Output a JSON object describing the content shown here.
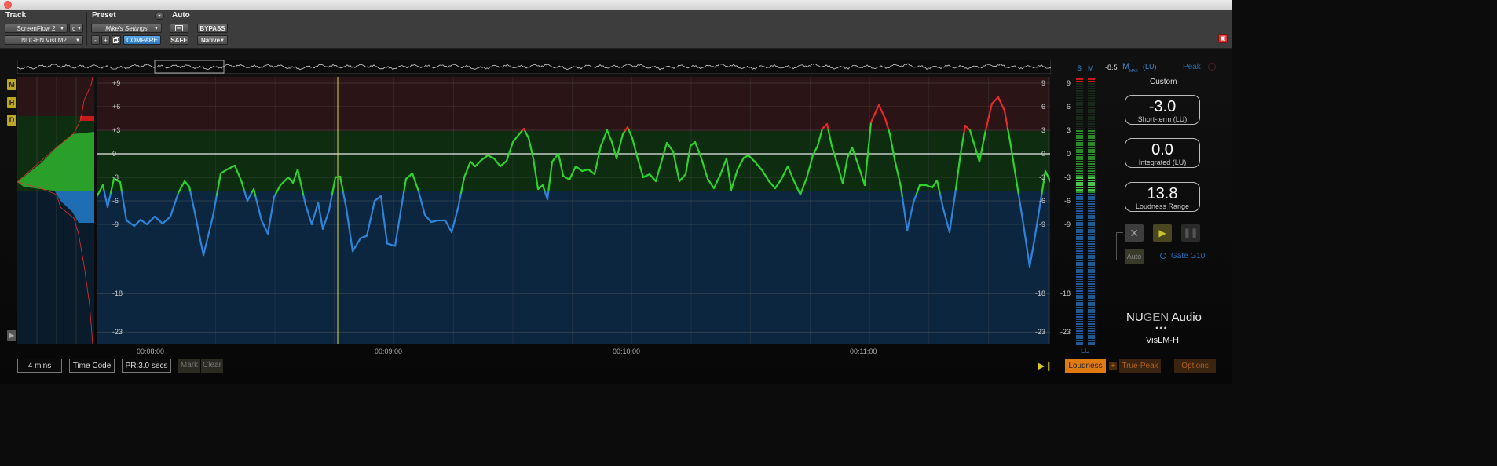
{
  "window": {
    "title": ""
  },
  "protools_header": {
    "track_label": "Track",
    "preset_label": "Preset",
    "auto_label": "Auto",
    "track_name": "ScreenFlow 2",
    "track_channel": "c",
    "plugin_name": "NUGEN VisLM2",
    "preset_name": "Mike's Settings",
    "compare_label": "COMPARE",
    "minus_label": "-",
    "plus_label": "+",
    "bypass_label": "BYPASS",
    "safe_label": "SAFE",
    "native_label": "Native"
  },
  "side_buttons": [
    "M",
    "H",
    "D"
  ],
  "plot": {
    "y_ticks_left": [
      "+9",
      "+6",
      "+3",
      "0",
      "-3",
      "-6",
      "-9",
      "-18",
      "-23"
    ],
    "time_labels": [
      "00:08:00",
      "00:09:00",
      "00:10:00",
      "00:11:00"
    ]
  },
  "meter": {
    "s_label": "S",
    "m_label": "M",
    "lu_label": "LU",
    "scale": [
      "9",
      "6",
      "3",
      "0",
      "-3",
      "-6",
      "-9",
      "-18",
      "-23"
    ],
    "colors": {
      "blue": "#1f6fb4",
      "green": "#2fae2f",
      "red": "#d41d1d"
    }
  },
  "right_panel": {
    "mmax_value": "-8.5",
    "mmax_label": "M",
    "mmax_sub": "MAX",
    "mmax_unit": "(LU)",
    "peak_label": "Peak",
    "preset_label": "Custom",
    "short_term_value": "-3.0",
    "short_term_label": "Short-term (LU)",
    "integrated_value": "0.0",
    "integrated_label": "Integrated (LU)",
    "lra_value": "13.8",
    "lra_label": "Loudness Range",
    "auto_label": "Auto",
    "gate_label": "Gate G10",
    "brand_nu": "NU",
    "brand_gen": "GEN",
    "brand_audio": " Audio",
    "brand_dots": "●●●",
    "product": "VisLM-H"
  },
  "bottom_bar": {
    "time_window": "4 mins",
    "time_code": "Time Code",
    "pr": "PR:3.0 secs",
    "mark": "Mark",
    "clear": "Clear",
    "loudness": "Loudness",
    "plus": "+",
    "true_peak": "True-Peak",
    "options": "Options"
  },
  "colors": {
    "accent_orange": "#e07a12",
    "zone_red": "#3a1618",
    "zone_green": "#103a14",
    "zone_blue": "#0d2a45",
    "marker_yellow": "#d8d84a"
  }
}
